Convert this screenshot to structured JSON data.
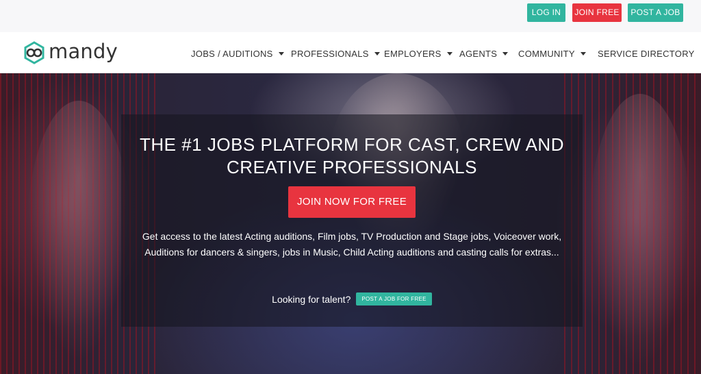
{
  "topbar": {
    "login_label": "LOG IN",
    "join_label": "JOIN FREE",
    "post_job_label": "POST A JOB"
  },
  "brand": {
    "name": "mandy"
  },
  "nav": {
    "items": [
      {
        "label": "JOBS / AUDITIONS",
        "dropdown": true
      },
      {
        "label": "PROFESSIONALS",
        "dropdown": true
      },
      {
        "label": "EMPLOYERS",
        "dropdown": true
      },
      {
        "label": "AGENTS",
        "dropdown": true
      },
      {
        "label": "COMMUNITY",
        "dropdown": true
      },
      {
        "label": "SERVICE DIRECTORY",
        "dropdown": false
      }
    ]
  },
  "hero": {
    "title_line1": "THE #1 JOBS PLATFORM FOR CAST, CREW AND",
    "title_line2": "CREATIVE PROFESSIONALS",
    "cta_label": "JOIN NOW FOR FREE",
    "description": "Get access to the latest Acting auditions, Film jobs, TV Production and Stage jobs, Voiceover work, Auditions for dancers & singers, jobs in Music, Child Acting auditions and casting calls for extras...",
    "talent_prompt": "Looking for talent?",
    "post_job_free_label": "POST A JOB FOR FREE"
  },
  "colors": {
    "teal": "#31b59f",
    "red": "#e8343f"
  }
}
